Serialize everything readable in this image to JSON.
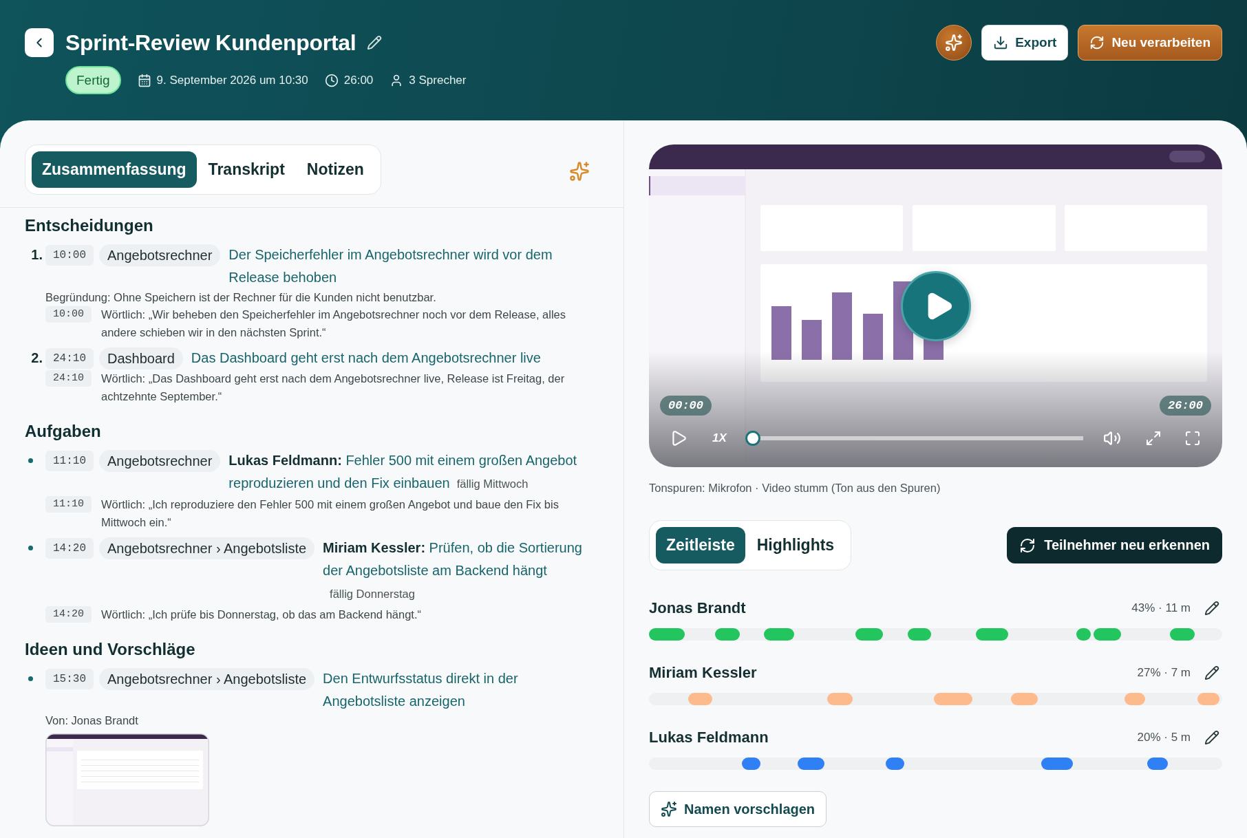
{
  "header": {
    "title": "Sprint-Review Kundenportal",
    "status": "Fertig",
    "meta": [
      {
        "kind": "date",
        "text": "9. September 2026 um 10:30"
      },
      {
        "kind": "duration",
        "text": "26:00"
      },
      {
        "kind": "speakers",
        "text": "3 Sprecher"
      }
    ],
    "actions": [
      {
        "kind": "ai"
      },
      {
        "kind": "export",
        "label": "Export"
      },
      {
        "kind": "reprocess",
        "label": "Neu verarbeiten"
      }
    ]
  },
  "summary": {
    "tabs": [
      {
        "label": "Zusammenfassung",
        "selected": true
      },
      {
        "label": "Transkript",
        "selected": false
      },
      {
        "label": "Notizen",
        "selected": false
      }
    ],
    "sections": [
      {
        "heading": "Entscheidungen",
        "kind": "numbered",
        "items": [
          {
            "marker": "1.",
            "time": "10:00",
            "topic": "Angebotsrechner",
            "title": "Der Speicherfehler im Angebotsrechner wird vor dem Release behoben",
            "reason": "Begründung: Ohne Speichern ist der Rechner für die Kunden nicht benutzbar.",
            "quote_time": "10:00",
            "quote": "Wörtlich: „Wir beheben den Speicherfehler im Angebotsrechner noch vor dem Release, alles andere schieben wir in den nächsten Sprint.“"
          },
          {
            "marker": "2.",
            "time": "24:10",
            "topic": "Dashboard",
            "title": "Das Dashboard geht erst nach dem Angebotsrechner live",
            "quote_time": "24:10",
            "quote": "Wörtlich: „Das Dashboard geht erst nach dem Angebotsrechner live, Release ist Freitag, der achtzehnte September.“"
          }
        ]
      },
      {
        "heading": "Aufgaben",
        "kind": "bulleted",
        "items": [
          {
            "time": "11:10",
            "topic": "Angebotsrechner",
            "title": "**Lukas Feldmann:** Fehler 500 mit einem großen Angebot reproduzieren und den Fix einbauen",
            "due": "fällig Mittwoch",
            "quote_time": "11:10",
            "quote": "Wörtlich: „Ich reproduziere den Fehler 500 mit einem großen Angebot und baue den Fix bis Mittwoch ein.“"
          },
          {
            "time": "14:20",
            "topic": "Angebotsrechner › Angebotsliste",
            "title": "**Miriam Kessler:** Prüfen, ob die Sortierung der Angebotsliste am Backend hängt",
            "due": "fällig Donnerstag",
            "quote_time": "14:20",
            "quote": "Wörtlich: „Ich prüfe bis Donnerstag, ob das am Backend hängt.“"
          }
        ]
      },
      {
        "heading": "Ideen und Vorschläge",
        "kind": "bulleted",
        "items": [
          {
            "time": "15:30",
            "topic": "Angebotsrechner › Angebotsliste",
            "title": "Den Entwurfsstatus direkt in der Angebotsliste anzeigen",
            "author": "Von: Jonas Brandt",
            "attachment": {
              "kind": "screenshot"
            }
          }
        ]
      }
    ]
  },
  "media": {
    "video": {
      "current_time": "00:00",
      "total_time": "26:00",
      "speed": "1X",
      "progress": {
        "level": 0
      }
    },
    "audio_note": "Tonspuren: Mikrofon · Video stumm (Ton aus den Spuren)"
  },
  "timeline": {
    "tabs": [
      {
        "label": "Zeitleiste",
        "selected": true
      },
      {
        "label": "Highlights",
        "selected": false
      }
    ],
    "action": "Teilnehmer neu erkennen",
    "speakers": [
      {
        "name": "Jonas Brandt",
        "stats": "43% · 11 m",
        "color": "#22c55e"
      },
      {
        "name": "Miriam Kessler",
        "stats": "27% · 7 m",
        "color": "#fdba8c"
      },
      {
        "name": "Lukas Feldmann",
        "stats": "20% · 5 m",
        "color": "#2f80f5"
      }
    ],
    "suggest": "Namen vorschlagen"
  }
}
